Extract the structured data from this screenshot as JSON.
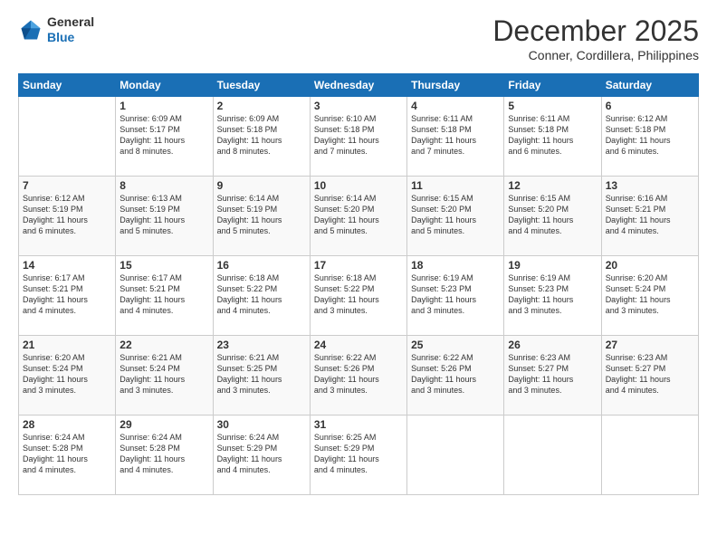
{
  "logo": {
    "line1": "General",
    "line2": "Blue"
  },
  "header": {
    "month": "December 2025",
    "location": "Conner, Cordillera, Philippines"
  },
  "weekdays": [
    "Sunday",
    "Monday",
    "Tuesday",
    "Wednesday",
    "Thursday",
    "Friday",
    "Saturday"
  ],
  "weeks": [
    [
      {
        "day": "",
        "info": ""
      },
      {
        "day": "1",
        "info": "Sunrise: 6:09 AM\nSunset: 5:17 PM\nDaylight: 11 hours\nand 8 minutes."
      },
      {
        "day": "2",
        "info": "Sunrise: 6:09 AM\nSunset: 5:18 PM\nDaylight: 11 hours\nand 8 minutes."
      },
      {
        "day": "3",
        "info": "Sunrise: 6:10 AM\nSunset: 5:18 PM\nDaylight: 11 hours\nand 7 minutes."
      },
      {
        "day": "4",
        "info": "Sunrise: 6:11 AM\nSunset: 5:18 PM\nDaylight: 11 hours\nand 7 minutes."
      },
      {
        "day": "5",
        "info": "Sunrise: 6:11 AM\nSunset: 5:18 PM\nDaylight: 11 hours\nand 6 minutes."
      },
      {
        "day": "6",
        "info": "Sunrise: 6:12 AM\nSunset: 5:18 PM\nDaylight: 11 hours\nand 6 minutes."
      }
    ],
    [
      {
        "day": "7",
        "info": "Sunrise: 6:12 AM\nSunset: 5:19 PM\nDaylight: 11 hours\nand 6 minutes."
      },
      {
        "day": "8",
        "info": "Sunrise: 6:13 AM\nSunset: 5:19 PM\nDaylight: 11 hours\nand 5 minutes."
      },
      {
        "day": "9",
        "info": "Sunrise: 6:14 AM\nSunset: 5:19 PM\nDaylight: 11 hours\nand 5 minutes."
      },
      {
        "day": "10",
        "info": "Sunrise: 6:14 AM\nSunset: 5:20 PM\nDaylight: 11 hours\nand 5 minutes."
      },
      {
        "day": "11",
        "info": "Sunrise: 6:15 AM\nSunset: 5:20 PM\nDaylight: 11 hours\nand 5 minutes."
      },
      {
        "day": "12",
        "info": "Sunrise: 6:15 AM\nSunset: 5:20 PM\nDaylight: 11 hours\nand 4 minutes."
      },
      {
        "day": "13",
        "info": "Sunrise: 6:16 AM\nSunset: 5:21 PM\nDaylight: 11 hours\nand 4 minutes."
      }
    ],
    [
      {
        "day": "14",
        "info": "Sunrise: 6:17 AM\nSunset: 5:21 PM\nDaylight: 11 hours\nand 4 minutes."
      },
      {
        "day": "15",
        "info": "Sunrise: 6:17 AM\nSunset: 5:21 PM\nDaylight: 11 hours\nand 4 minutes."
      },
      {
        "day": "16",
        "info": "Sunrise: 6:18 AM\nSunset: 5:22 PM\nDaylight: 11 hours\nand 4 minutes."
      },
      {
        "day": "17",
        "info": "Sunrise: 6:18 AM\nSunset: 5:22 PM\nDaylight: 11 hours\nand 3 minutes."
      },
      {
        "day": "18",
        "info": "Sunrise: 6:19 AM\nSunset: 5:23 PM\nDaylight: 11 hours\nand 3 minutes."
      },
      {
        "day": "19",
        "info": "Sunrise: 6:19 AM\nSunset: 5:23 PM\nDaylight: 11 hours\nand 3 minutes."
      },
      {
        "day": "20",
        "info": "Sunrise: 6:20 AM\nSunset: 5:24 PM\nDaylight: 11 hours\nand 3 minutes."
      }
    ],
    [
      {
        "day": "21",
        "info": "Sunrise: 6:20 AM\nSunset: 5:24 PM\nDaylight: 11 hours\nand 3 minutes."
      },
      {
        "day": "22",
        "info": "Sunrise: 6:21 AM\nSunset: 5:24 PM\nDaylight: 11 hours\nand 3 minutes."
      },
      {
        "day": "23",
        "info": "Sunrise: 6:21 AM\nSunset: 5:25 PM\nDaylight: 11 hours\nand 3 minutes."
      },
      {
        "day": "24",
        "info": "Sunrise: 6:22 AM\nSunset: 5:26 PM\nDaylight: 11 hours\nand 3 minutes."
      },
      {
        "day": "25",
        "info": "Sunrise: 6:22 AM\nSunset: 5:26 PM\nDaylight: 11 hours\nand 3 minutes."
      },
      {
        "day": "26",
        "info": "Sunrise: 6:23 AM\nSunset: 5:27 PM\nDaylight: 11 hours\nand 3 minutes."
      },
      {
        "day": "27",
        "info": "Sunrise: 6:23 AM\nSunset: 5:27 PM\nDaylight: 11 hours\nand 4 minutes."
      }
    ],
    [
      {
        "day": "28",
        "info": "Sunrise: 6:24 AM\nSunset: 5:28 PM\nDaylight: 11 hours\nand 4 minutes."
      },
      {
        "day": "29",
        "info": "Sunrise: 6:24 AM\nSunset: 5:28 PM\nDaylight: 11 hours\nand 4 minutes."
      },
      {
        "day": "30",
        "info": "Sunrise: 6:24 AM\nSunset: 5:29 PM\nDaylight: 11 hours\nand 4 minutes."
      },
      {
        "day": "31",
        "info": "Sunrise: 6:25 AM\nSunset: 5:29 PM\nDaylight: 11 hours\nand 4 minutes."
      },
      {
        "day": "",
        "info": ""
      },
      {
        "day": "",
        "info": ""
      },
      {
        "day": "",
        "info": ""
      }
    ]
  ],
  "colors": {
    "header_bg": "#1a6fb5",
    "header_text": "#ffffff",
    "border": "#cccccc"
  }
}
